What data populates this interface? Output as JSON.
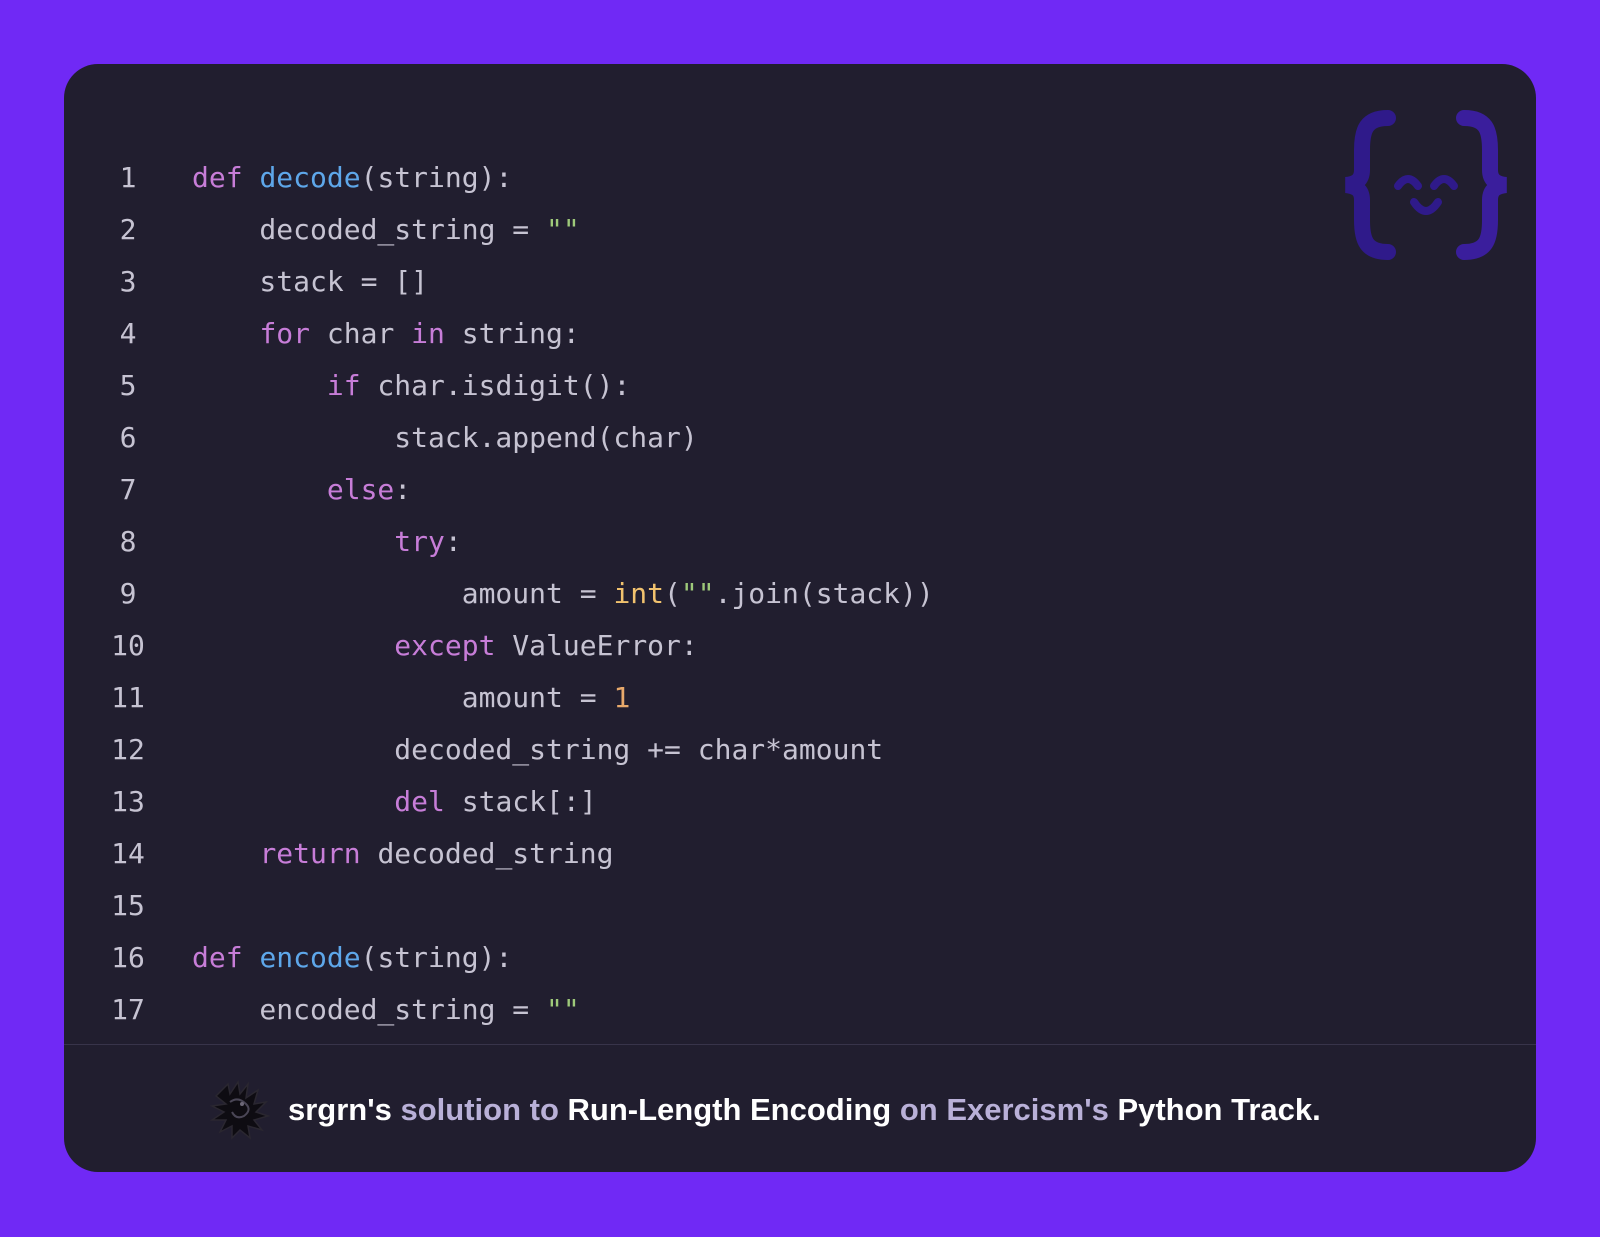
{
  "code": {
    "language": "python",
    "lines": [
      {
        "number": "1",
        "tokens": [
          {
            "type": "keyword",
            "text": "def"
          },
          {
            "type": "plain",
            "text": " "
          },
          {
            "type": "function",
            "text": "decode"
          },
          {
            "type": "plain",
            "text": "(string):"
          }
        ]
      },
      {
        "number": "2",
        "tokens": [
          {
            "type": "plain",
            "text": "    decoded_string = "
          },
          {
            "type": "string",
            "text": "\"\""
          }
        ]
      },
      {
        "number": "3",
        "tokens": [
          {
            "type": "plain",
            "text": "    stack = []"
          }
        ]
      },
      {
        "number": "4",
        "tokens": [
          {
            "type": "plain",
            "text": "    "
          },
          {
            "type": "keyword",
            "text": "for"
          },
          {
            "type": "plain",
            "text": " char "
          },
          {
            "type": "keyword",
            "text": "in"
          },
          {
            "type": "plain",
            "text": " string:"
          }
        ]
      },
      {
        "number": "5",
        "tokens": [
          {
            "type": "plain",
            "text": "        "
          },
          {
            "type": "keyword",
            "text": "if"
          },
          {
            "type": "plain",
            "text": " char.isdigit():"
          }
        ]
      },
      {
        "number": "6",
        "tokens": [
          {
            "type": "plain",
            "text": "            stack.append(char)"
          }
        ]
      },
      {
        "number": "7",
        "tokens": [
          {
            "type": "plain",
            "text": "        "
          },
          {
            "type": "keyword",
            "text": "else"
          },
          {
            "type": "plain",
            "text": ":"
          }
        ]
      },
      {
        "number": "8",
        "tokens": [
          {
            "type": "plain",
            "text": "            "
          },
          {
            "type": "keyword",
            "text": "try"
          },
          {
            "type": "plain",
            "text": ":"
          }
        ]
      },
      {
        "number": "9",
        "tokens": [
          {
            "type": "plain",
            "text": "                amount = "
          },
          {
            "type": "builtin",
            "text": "int"
          },
          {
            "type": "plain",
            "text": "("
          },
          {
            "type": "string",
            "text": "\"\""
          },
          {
            "type": "plain",
            "text": ".join(stack))"
          }
        ]
      },
      {
        "number": "10",
        "tokens": [
          {
            "type": "plain",
            "text": "            "
          },
          {
            "type": "keyword",
            "text": "except"
          },
          {
            "type": "plain",
            "text": " ValueError:"
          }
        ]
      },
      {
        "number": "11",
        "tokens": [
          {
            "type": "plain",
            "text": "                amount = "
          },
          {
            "type": "number",
            "text": "1"
          }
        ]
      },
      {
        "number": "12",
        "tokens": [
          {
            "type": "plain",
            "text": "            decoded_string += char*amount"
          }
        ]
      },
      {
        "number": "13",
        "tokens": [
          {
            "type": "plain",
            "text": "            "
          },
          {
            "type": "keyword",
            "text": "del"
          },
          {
            "type": "plain",
            "text": " stack[:]"
          }
        ]
      },
      {
        "number": "14",
        "tokens": [
          {
            "type": "plain",
            "text": "    "
          },
          {
            "type": "keyword",
            "text": "return"
          },
          {
            "type": "plain",
            "text": " decoded_string"
          }
        ]
      },
      {
        "number": "15",
        "tokens": []
      },
      {
        "number": "16",
        "tokens": [
          {
            "type": "keyword",
            "text": "def"
          },
          {
            "type": "plain",
            "text": " "
          },
          {
            "type": "function",
            "text": "encode"
          },
          {
            "type": "plain",
            "text": "(string):"
          }
        ]
      },
      {
        "number": "17",
        "tokens": [
          {
            "type": "plain",
            "text": "    encoded_string = "
          },
          {
            "type": "string",
            "text": "\"\""
          }
        ]
      }
    ]
  },
  "logo": {
    "icon": "exercism-face-icon"
  },
  "footer": {
    "avatar_icon": "dragon-avatar-icon",
    "username": "srgrn's",
    "text_solution": " solution to ",
    "exercise": "Run-Length Encoding",
    "text_on": " on ",
    "site": "Exercism's",
    "track": " Python Track."
  },
  "colors": {
    "background": "#7029f5",
    "card": "#211e2f",
    "keyword": "#c77dd8",
    "function": "#5ea7ea",
    "string": "#9ec97a",
    "builtin": "#f1c26e",
    "number": "#e8a96b",
    "text": "#c6c3d2"
  }
}
